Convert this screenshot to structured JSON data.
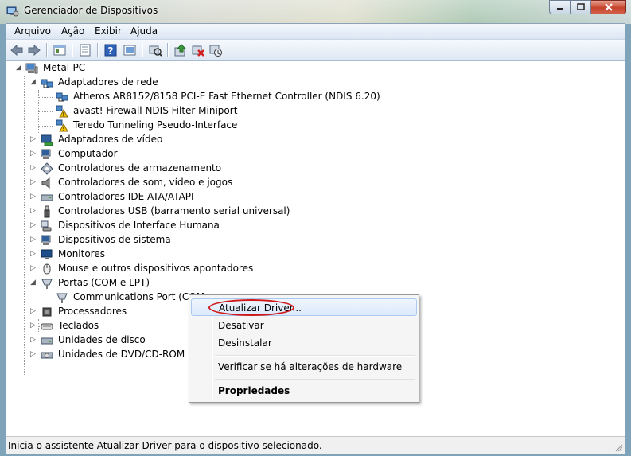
{
  "window": {
    "title": "Gerenciador de Dispositivos"
  },
  "menubar": {
    "items": [
      "Arquivo",
      "Ação",
      "Exibir",
      "Ajuda"
    ]
  },
  "toolbar": {
    "buttons": [
      "back-icon",
      "forward-icon",
      "tree-view-icon",
      "properties-icon",
      "help-icon",
      "show-devices-icon",
      "scan-hardware-icon",
      "update-driver-icon",
      "uninstall-icon",
      "disable-icon"
    ]
  },
  "tree": {
    "root": "Metal-PC",
    "nodes": [
      {
        "label": "Adaptadores de rede",
        "expanded": true,
        "icon": "network-icon",
        "children": [
          "Atheros AR8152/8158 PCI-E Fast Ethernet Controller (NDIS 6.20)",
          "avast! Firewall NDIS Filter Miniport",
          "Teredo Tunneling Pseudo-Interface"
        ]
      },
      {
        "label": "Adaptadores de vídeo",
        "icon": "display-adapter-icon"
      },
      {
        "label": "Computador",
        "icon": "computer-icon"
      },
      {
        "label": "Controladores de armazenamento",
        "icon": "storage-icon"
      },
      {
        "label": "Controladores de som, vídeo e jogos",
        "icon": "speaker-icon"
      },
      {
        "label": "Controladores IDE ATA/ATAPI",
        "icon": "ide-icon"
      },
      {
        "label": "Controladores USB (barramento serial universal)",
        "icon": "usb-icon"
      },
      {
        "label": "Dispositivos de Interface Humana",
        "icon": "hid-icon"
      },
      {
        "label": "Dispositivos de sistema",
        "icon": "system-icon"
      },
      {
        "label": "Monitores",
        "icon": "monitor-icon"
      },
      {
        "label": "Mouse e outros dispositivos apontadores",
        "icon": "mouse-icon"
      },
      {
        "label": "Portas (COM e LPT)",
        "expanded": true,
        "icon": "port-icon",
        "children": [
          "Communications Port (COM"
        ]
      },
      {
        "label": "Processadores",
        "icon": "processor-icon"
      },
      {
        "label": "Teclados",
        "icon": "keyboard-icon"
      },
      {
        "label": "Unidades de disco",
        "icon": "disk-icon"
      },
      {
        "label": "Unidades de DVD/CD-ROM",
        "icon": "dvd-icon"
      }
    ]
  },
  "context_menu": {
    "items": [
      {
        "label": "Atualizar Driver...",
        "highlighted": true
      },
      {
        "label": "Desativar"
      },
      {
        "label": "Desinstalar"
      },
      {
        "label": "Verificar se há alterações de hardware"
      },
      {
        "label": "Propriedades",
        "bold": true
      }
    ]
  },
  "statusbar": {
    "text": "Inicia o assistente Atualizar Driver para o dispositivo selecionado."
  },
  "colors": {
    "highlight_border": "#a8caf0",
    "annotation_oval": "#d01818",
    "warning": "#f2c200"
  }
}
